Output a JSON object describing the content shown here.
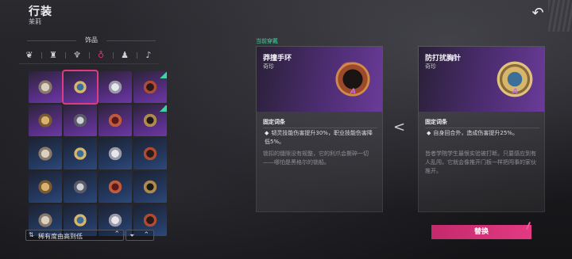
{
  "header": {
    "title": "行装",
    "subtitle": "茉莉",
    "back_icon": "back-arrow-icon"
  },
  "inventory": {
    "category_label": "饰品",
    "slot_tabs": [
      {
        "icon": "feather-icon",
        "glyph": "❦",
        "active": false
      },
      {
        "icon": "bell-charm-icon",
        "glyph": "♜",
        "active": false
      },
      {
        "icon": "wing-charm-icon",
        "glyph": "♆",
        "active": false
      },
      {
        "icon": "ring-pendant-icon",
        "glyph": "♁",
        "active": true
      },
      {
        "icon": "bell-icon",
        "glyph": "♟",
        "active": false
      },
      {
        "icon": "horn-icon",
        "glyph": "♪",
        "active": false
      }
    ],
    "items": [
      {
        "name": "item-feather-pendant",
        "rarity": "purple",
        "selected": false,
        "new": false
      },
      {
        "name": "item-gear-brooch",
        "rarity": "purple",
        "selected": true,
        "new": false
      },
      {
        "name": "item-silver-charm",
        "rarity": "purple",
        "selected": false,
        "new": false
      },
      {
        "name": "item-spiked-bracelet",
        "rarity": "purple",
        "selected": false,
        "new": true
      },
      {
        "name": "item-gear-brooch-2",
        "rarity": "purple",
        "selected": false,
        "new": false
      },
      {
        "name": "item-pearl-charm",
        "rarity": "purple",
        "selected": false,
        "new": false
      },
      {
        "name": "item-spiked-ring",
        "rarity": "purple",
        "selected": false,
        "new": false
      },
      {
        "name": "item-gold-ring",
        "rarity": "purple",
        "selected": false,
        "new": true
      },
      {
        "name": "item-red-amulet",
        "rarity": "blue",
        "selected": false,
        "new": false
      },
      {
        "name": "item-dark-ring",
        "rarity": "blue",
        "selected": false,
        "new": false
      },
      {
        "name": "item-gold-locket",
        "rarity": "blue",
        "selected": false,
        "new": false
      },
      {
        "name": "item-dark-ring-2",
        "rarity": "blue",
        "selected": false,
        "new": false
      },
      {
        "name": "item-skull-charm",
        "rarity": "blue",
        "selected": false,
        "new": false
      },
      {
        "name": "item-ruby-ring",
        "rarity": "blue",
        "selected": false,
        "new": false
      },
      {
        "name": "item-pocket-watch",
        "rarity": "blue",
        "selected": false,
        "new": false
      },
      {
        "name": "item-black-band",
        "rarity": "blue",
        "selected": false,
        "new": false
      },
      {
        "name": "item-bead-charm",
        "rarity": "blue",
        "selected": false,
        "new": false
      },
      {
        "name": "item-iron-ring",
        "rarity": "blue",
        "selected": false,
        "new": false
      },
      {
        "name": "item-bone-charm",
        "rarity": "blue",
        "selected": false,
        "new": false
      },
      {
        "name": "item-steel-band",
        "rarity": "blue",
        "selected": false,
        "new": false
      }
    ],
    "sort_label": "稀有度由高到低",
    "sort_icon": "sort-icon",
    "filter_icon": "filter-icon"
  },
  "current_label": "当前穿戴",
  "equipped": {
    "name": "莽撞手环",
    "rarity": "奇珍",
    "tier": "A",
    "fixed_title": "固定词条",
    "effect": "韧灵技能伤害提升30%，职业技能伤害降低5%。",
    "flavor": "锁扣的缝隙没有规整，它的利爪会撕碎一切——哪怕是黑格尔的锁船。"
  },
  "candidate": {
    "name": "防打扰胸针",
    "rarity": "奇珍",
    "tier": "A",
    "fixed_title": "固定词条",
    "effect": "自身回合外，造成伤害提升25%。",
    "flavor": "皆者学院学生最恨实验被打断。只要感应到有人乱闯，它就会像推开门板一样把闯事的家伙推开。"
  },
  "compare_glyph": "<",
  "swap_label": "替换",
  "colors": {
    "accent": "#e23a82",
    "rarity_purple": "#5a2f8a",
    "rarity_blue": "#243a63",
    "new_marker": "#3bd6a0"
  }
}
